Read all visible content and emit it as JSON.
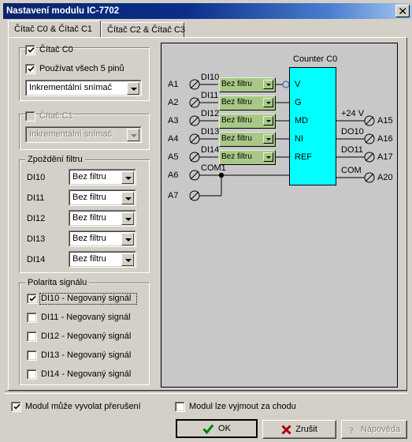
{
  "window": {
    "title": "Nastavení modulu IC-7702",
    "close_icon": "close-icon"
  },
  "tabs": [
    {
      "label": "Čítač C0 & Čítač C1",
      "selected": true
    },
    {
      "label": "Čítač C2 & Čítač C3",
      "selected": false
    }
  ],
  "counter_c0_group": {
    "enable_checkbox": {
      "label": "Čítač C0",
      "checked": true
    },
    "use_all_pins_checkbox": {
      "label": "Používat všech 5 pinů",
      "checked": true
    },
    "mode_combo": {
      "value": "Inkrementální snímač",
      "enabled": true
    }
  },
  "counter_c1_group": {
    "enable_checkbox": {
      "label": "Čítač C1",
      "checked": false
    },
    "mode_combo": {
      "value": "Inkrementální snímač",
      "enabled": false
    }
  },
  "filter_delay_group": {
    "title": "Zpoždění filtru",
    "rows": [
      {
        "label": "DI10",
        "value": "Bez filtru"
      },
      {
        "label": "DI11",
        "value": "Bez filtru"
      },
      {
        "label": "DI12",
        "value": "Bez filtru"
      },
      {
        "label": "DI13",
        "value": "Bez filtru"
      },
      {
        "label": "DI14",
        "value": "Bez filtru"
      }
    ]
  },
  "signal_polarity_group": {
    "title": "Polarita signálu",
    "rows": [
      {
        "label": "DI10 - Negovaný signál",
        "checked": true,
        "focused": true
      },
      {
        "label": "DI11 - Negovaný signál",
        "checked": false,
        "focused": false
      },
      {
        "label": "DI12 - Negovaný signál",
        "checked": false,
        "focused": false
      },
      {
        "label": "DI13 - Negovaný signál",
        "checked": false,
        "focused": false
      },
      {
        "label": "DI14 - Negovaný signál",
        "checked": false,
        "focused": false
      }
    ]
  },
  "diagram": {
    "block_title": "Counter C0",
    "block_color": "#00ffff",
    "filter_combo_color": "#a8c888",
    "inputs": [
      {
        "terminal": "A1",
        "signal": "DI10",
        "filter": "Bez filtru",
        "pin": "V",
        "negated": true
      },
      {
        "terminal": "A2",
        "signal": "DI11",
        "filter": "Bez filtru",
        "pin": "G",
        "negated": false
      },
      {
        "terminal": "A3",
        "signal": "DI12",
        "filter": "Bez filtru",
        "pin": "MD",
        "negated": false
      },
      {
        "terminal": "A4",
        "signal": "DI13",
        "filter": "Bez filtru",
        "pin": "NI",
        "negated": false
      },
      {
        "terminal": "A5",
        "signal": "DI14",
        "filter": "Bez filtru",
        "pin": "REF",
        "negated": false
      }
    ],
    "common": [
      {
        "terminal": "A6",
        "signal": "COM1"
      },
      {
        "terminal": "A7",
        "signal": ""
      }
    ],
    "outputs": [
      {
        "signal": "+24 V",
        "terminal": "A15"
      },
      {
        "signal": "DO10",
        "terminal": "A16"
      },
      {
        "signal": "DO11",
        "terminal": "A17"
      },
      {
        "signal": "COM",
        "terminal": "A20"
      }
    ]
  },
  "footer": {
    "interrupt_checkbox": {
      "label": "Modul může vyvolat přerušení",
      "checked": true
    },
    "hotswap_checkbox": {
      "label": "Modul lze vyjmout za chodu",
      "checked": false
    },
    "ok_button": {
      "label": "OK",
      "icon": "check-icon",
      "enabled": true
    },
    "cancel_button": {
      "label": "Zrušit",
      "icon": "x-icon",
      "enabled": true
    },
    "help_button": {
      "label": "Nápověda",
      "icon": "question-icon",
      "enabled": false
    }
  }
}
